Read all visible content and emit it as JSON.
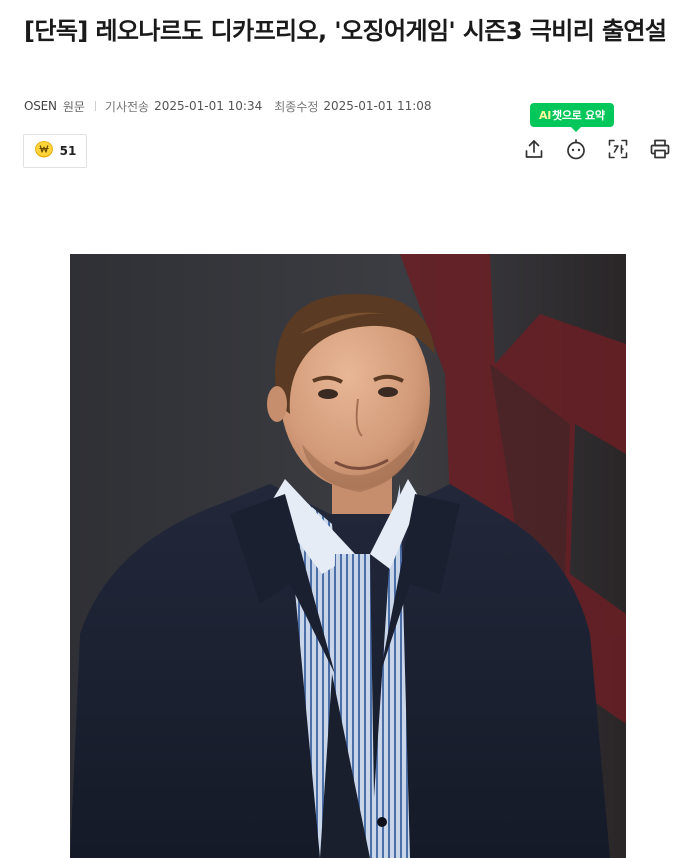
{
  "article": {
    "headline": "[단독] 레오나르도 디카프리오, '오징어게임' 시즌3 극비리 출연설"
  },
  "meta": {
    "press": "OSEN",
    "source_link": "원문",
    "published_label": "기사전송",
    "published_value": "2025-01-01 10:34",
    "modified_label": "최종수정",
    "modified_value": "2025-01-01 11:08"
  },
  "reaction": {
    "icon": "won-coin-icon",
    "count": "51"
  },
  "toolbar": {
    "ai_summary_tag": "AI",
    "ai_summary_label": "챗으로 요약",
    "share_icon": "share-icon",
    "ai_bot_icon": "ai-bot-icon",
    "font_size_icon": "font-size-icon",
    "print_icon": "print-icon"
  },
  "colors": {
    "accent": "#03c75a",
    "ai_tag": "#fff799",
    "reaction_coin": "#f2b705"
  }
}
